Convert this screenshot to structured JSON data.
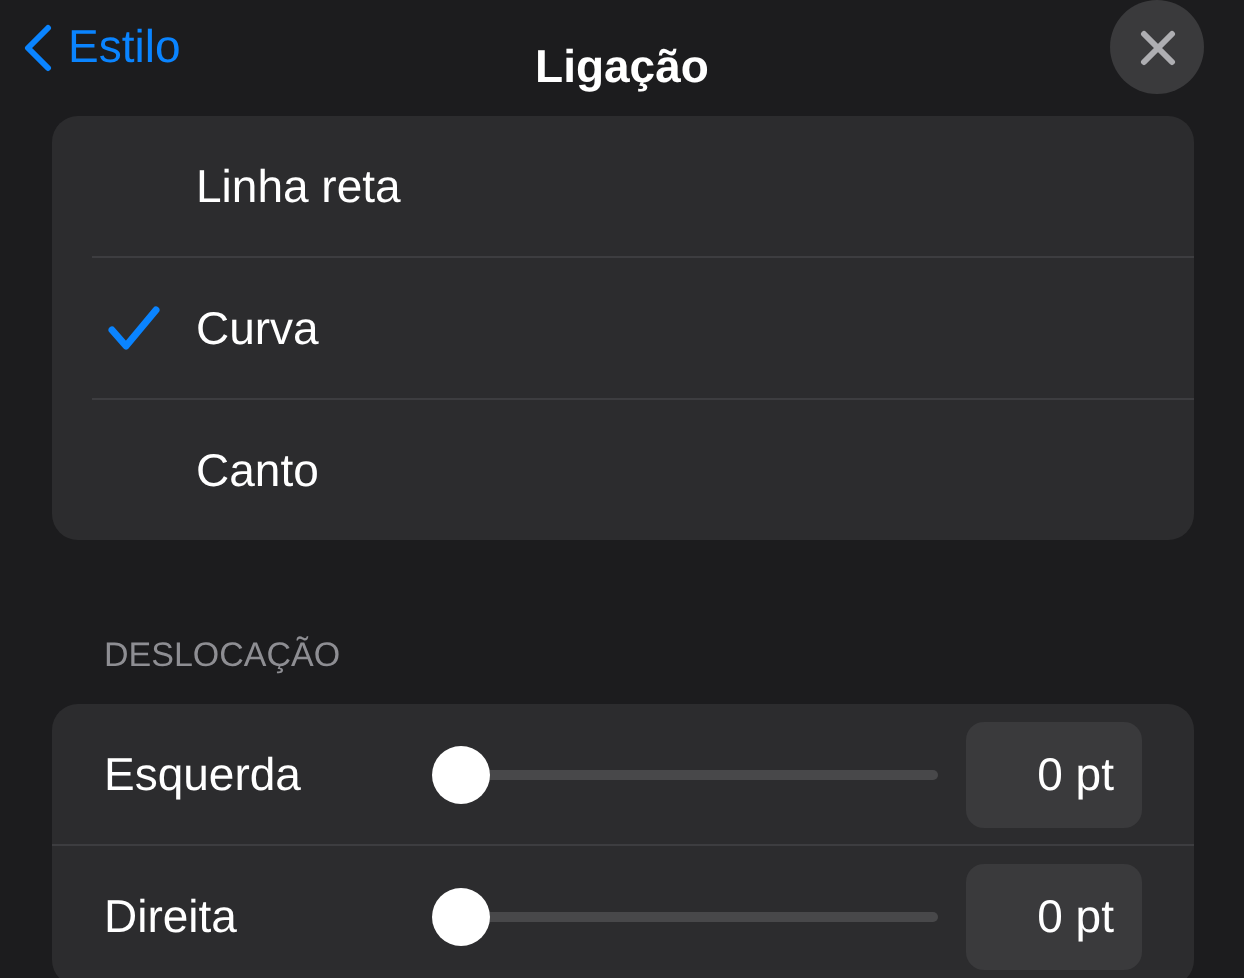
{
  "header": {
    "back": {
      "label": "Estilo"
    },
    "title": "Ligação"
  },
  "connection_types": [
    {
      "label": "Linha reta",
      "selected": false
    },
    {
      "label": "Curva",
      "selected": true
    },
    {
      "label": "Canto",
      "selected": false
    }
  ],
  "offset": {
    "heading": "DESLOCAÇÃO",
    "rows": [
      {
        "label": "Esquerda",
        "level": 0,
        "value": "0 pt"
      },
      {
        "label": "Direita",
        "level": 0,
        "value": "0 pt"
      }
    ]
  }
}
